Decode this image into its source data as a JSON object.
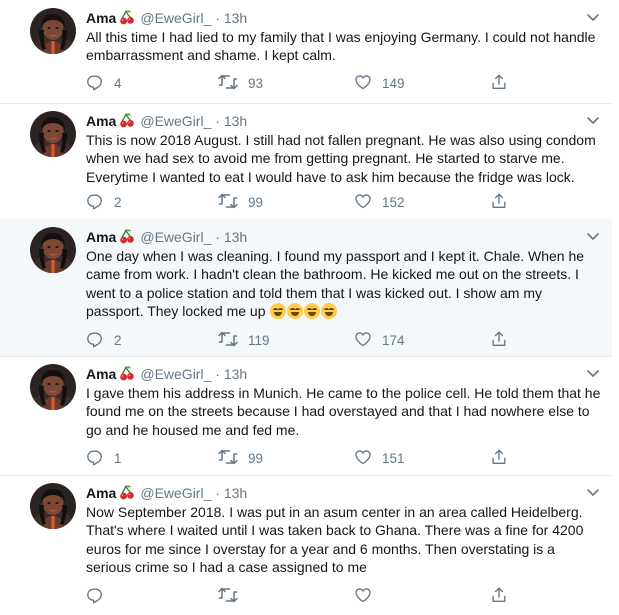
{
  "accent_colors": {
    "icon": "#657786",
    "text": "#14171a",
    "highlight_bg": "#f5f8fa"
  },
  "tweets": [
    {
      "name": "Ama",
      "handle": "@EweGirl_",
      "time": "13h",
      "text": "All this time I had lied to my family that I was enjoying Germany. I could not handle embarrassment and shame. I kept calm.",
      "replies": "4",
      "retweets": "93",
      "likes": "149"
    },
    {
      "name": "Ama",
      "handle": "@EweGirl_",
      "time": "13h",
      "text": "This is now 2018 August. I still had not fallen pregnant. He was also using condom when we had sex to avoid me from getting pregnant. He started to starve me. Everytime I wanted to eat I would have to ask him because the fridge was lock.",
      "replies": "2",
      "retweets": "99",
      "likes": "152"
    },
    {
      "name": "Ama",
      "handle": "@EweGirl_",
      "time": "13h",
      "text": "One day when I was cleaning. I found my passport and I kept it. Chale. When he came from work. I hadn't clean the bathroom. He kicked me out on the streets. I went to a police station and told them that I was kicked out. I show am my passport. They locked me up",
      "emoji": "laughing-tears-emoji",
      "replies": "2",
      "retweets": "119",
      "likes": "174"
    },
    {
      "name": "Ama",
      "handle": "@EweGirl_",
      "time": "13h",
      "text": "I gave them his address in Munich. He came to the police cell. He told them that he found me on the streets because I had overstayed and that I had nowhere else to go and he housed me and fed me.",
      "replies": "1",
      "retweets": "99",
      "likes": "151"
    },
    {
      "name": "Ama",
      "handle": "@EweGirl_",
      "time": "13h",
      "text": "Now September 2018. I was put in an asum center in an area called Heidelberg. That's where I waited until I was taken back to Ghana. There was a fine for 4200 euros for me since I overstay for a year and 6 months. Then overstating is a serious crime so I had a case assigned to me",
      "replies": "",
      "retweets": "",
      "likes": ""
    }
  ]
}
